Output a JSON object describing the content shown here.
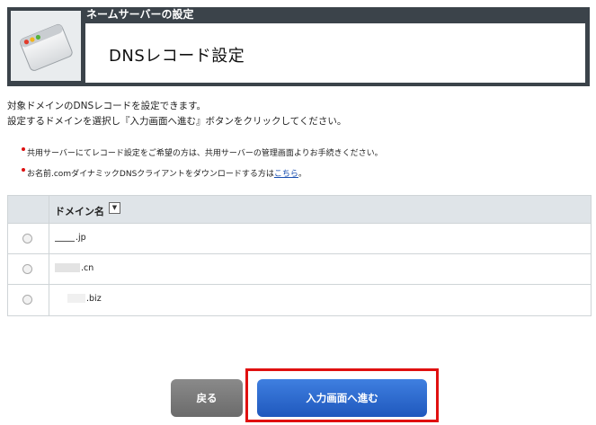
{
  "header": {
    "section_label": "ネームサーバーの設定",
    "title": "DNSレコード設定",
    "icon": "browser-window-icon"
  },
  "description": {
    "line1": "対象ドメインのDNSレコードを設定できます。",
    "line2": "設定するドメインを選択し『入力画面へ進む』ボタンをクリックしてください。"
  },
  "notes": [
    {
      "text": "共用サーバーにてレコード設定をご希望の方は、共用サーバーの管理画面よりお手続きください。"
    },
    {
      "text": "お名前.comダイナミックDNSクライアントをダウンロードする方は",
      "link": "こちら",
      "suffix": "。"
    }
  ],
  "table": {
    "header": "ドメイン名",
    "sort_icon": "▼",
    "rows": [
      {
        "domain": ".jp"
      },
      {
        "domain": ".cn"
      },
      {
        "domain": ".biz"
      }
    ]
  },
  "buttons": {
    "back": "戻る",
    "next": "入力画面へ進む"
  },
  "colors": {
    "header_bg": "#3b434a",
    "primary_button": "#2a6ad3",
    "secondary_button": "#7a7a7a",
    "highlight": "#e01010",
    "link": "#1a4fb0",
    "bullet": "#d11111"
  }
}
